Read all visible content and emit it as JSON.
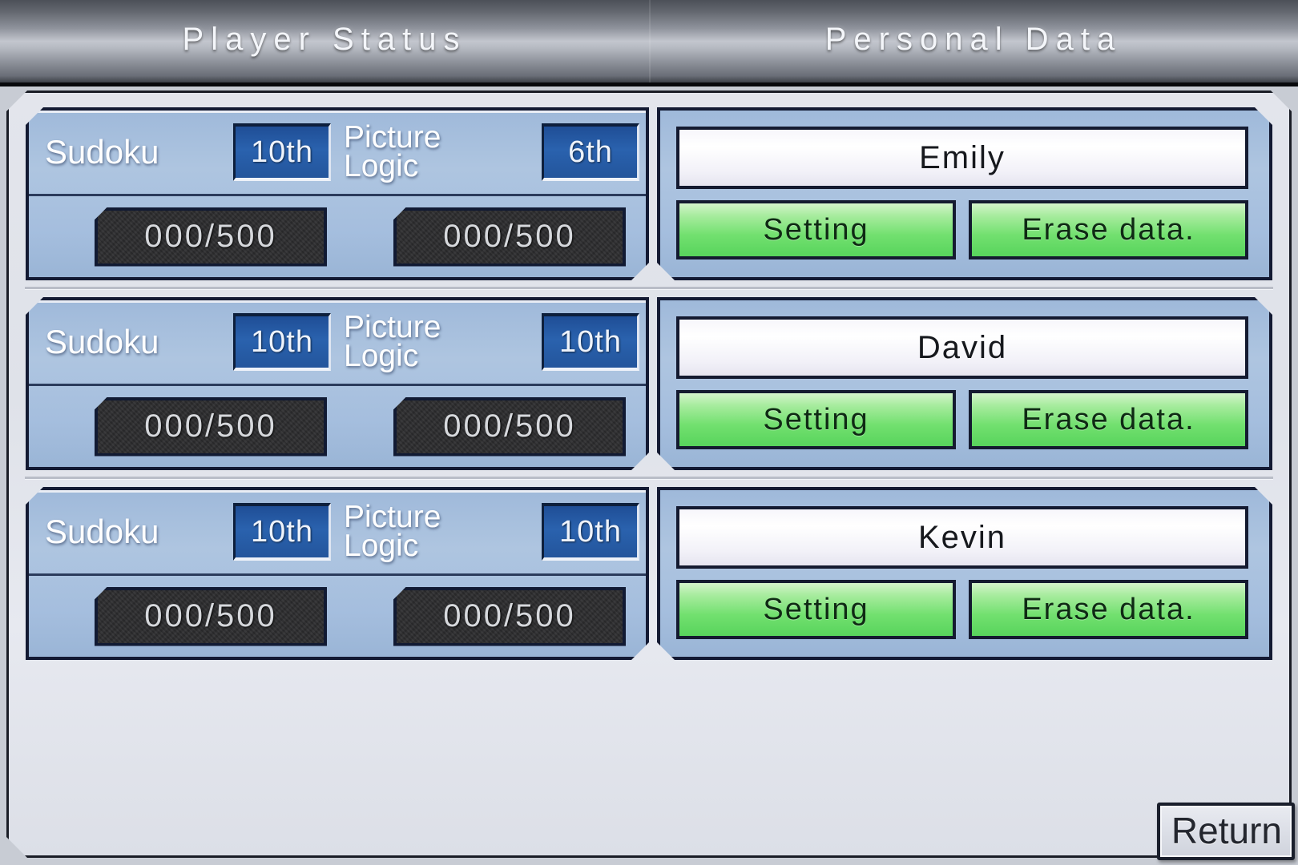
{
  "header": {
    "left_title": "Player Status",
    "right_title": "Personal Data"
  },
  "games": {
    "sudoku_label": "Sudoku",
    "picture_logic_label": "Picture\nLogic"
  },
  "buttons": {
    "setting_label": "Setting",
    "erase_label": "Erase data.",
    "return_label": "Return"
  },
  "colors": {
    "accent_blue": "#2a62ae",
    "card_blue": "#a5bede",
    "green_button": "#72e06f",
    "panel_light": "#e3e5ec",
    "border_navy": "#131a33"
  },
  "players": [
    {
      "name": "Emily",
      "sudoku_rank": "10th",
      "sudoku_progress": "000/500",
      "picture_logic_rank": "6th",
      "picture_logic_progress": "000/500",
      "setting_label": "Setting",
      "erase_label": "Erase data."
    },
    {
      "name": "David",
      "sudoku_rank": "10th",
      "sudoku_progress": "000/500",
      "picture_logic_rank": "10th",
      "picture_logic_progress": "000/500",
      "setting_label": "Setting",
      "erase_label": "Erase data."
    },
    {
      "name": "Kevin",
      "sudoku_rank": "10th",
      "sudoku_progress": "000/500",
      "picture_logic_rank": "10th",
      "picture_logic_progress": "000/500",
      "setting_label": "Setting",
      "erase_label": "Erase data."
    }
  ]
}
